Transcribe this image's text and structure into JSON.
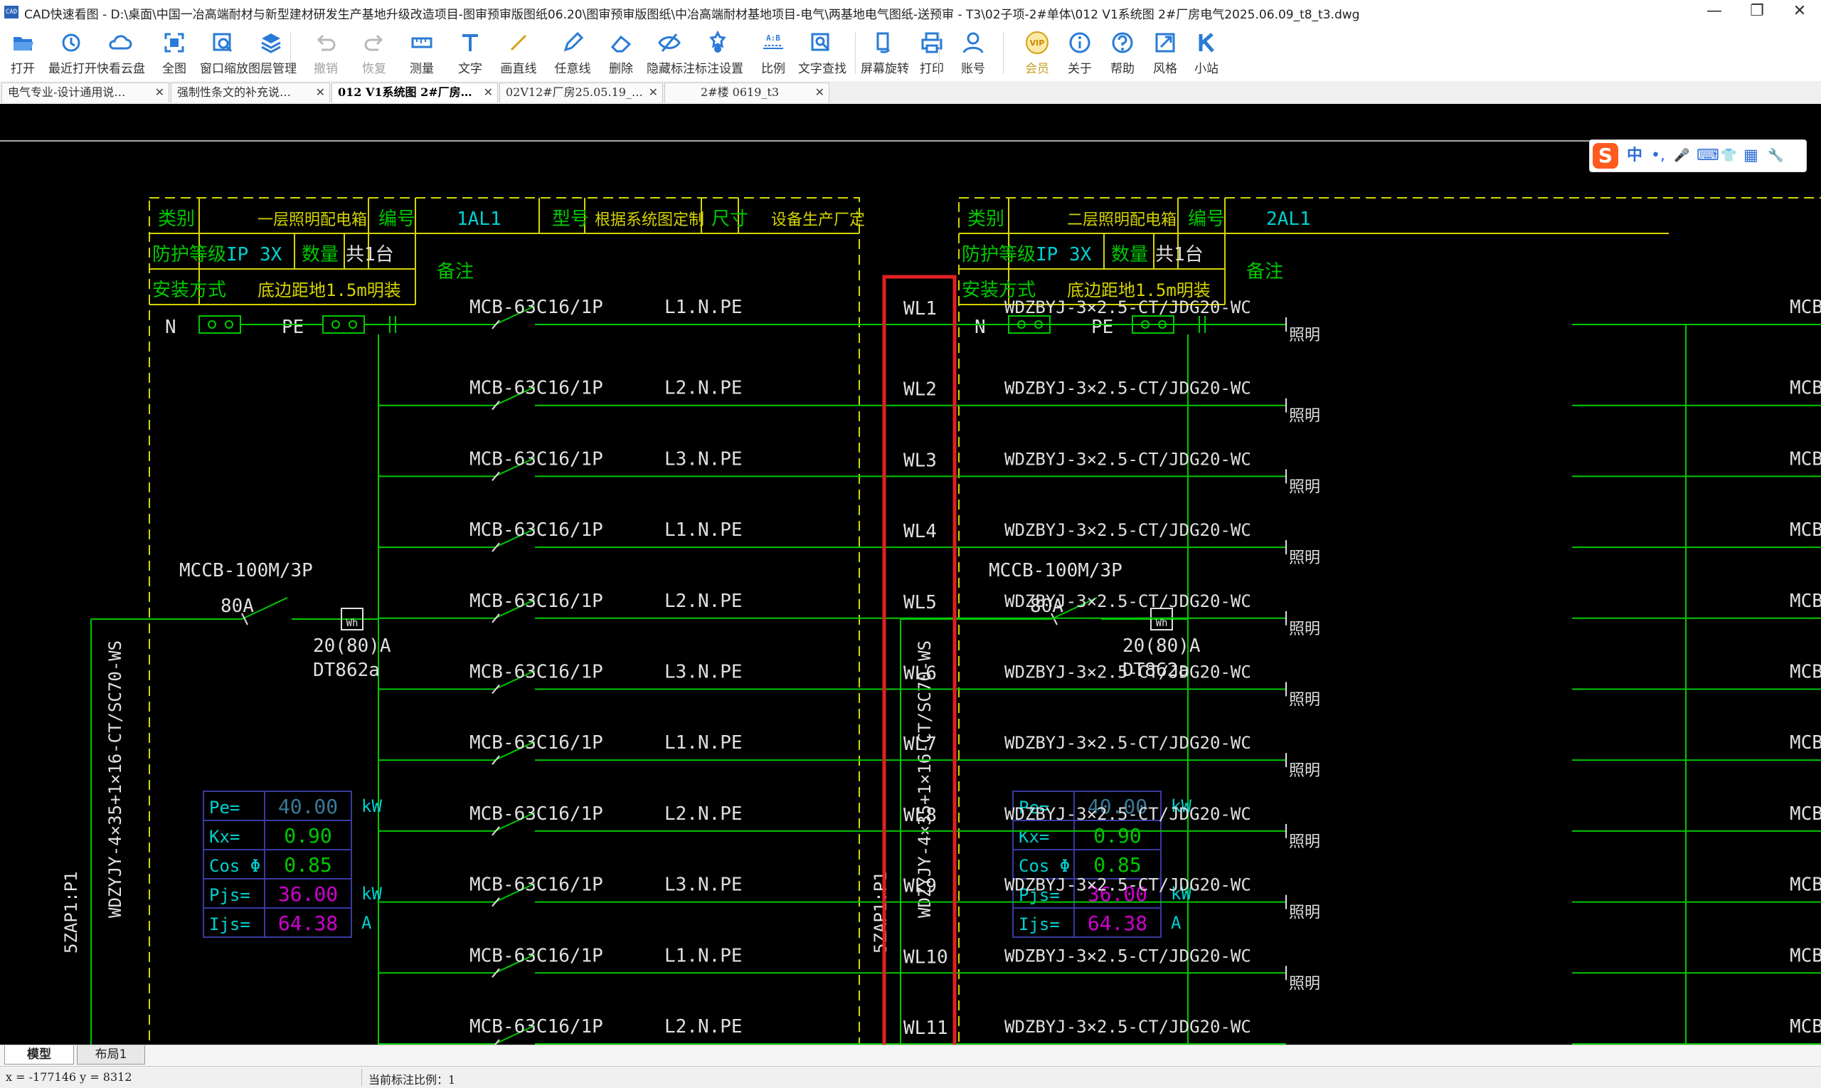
{
  "app": {
    "logo": "CAD",
    "window_title": "CAD快速看图 - D:\\桌面\\中国一冶高端耐材与新型建材研发生产基地升级改造项目-图审预审版图纸06.20\\图审预审版图纸\\中冶高端耐材基地项目-电气\\两基地电气图纸-送预审 - T3\\02子项-2#单体\\012 V1系统图 2#厂房电气2025.06.09_t8_t3.dwg",
    "controls": {
      "minimize": "—",
      "maximize": "❐",
      "close": "✕"
    }
  },
  "toolbar": [
    {
      "label": "打开",
      "icon": "folder-open-icon",
      "enabled": true
    },
    {
      "label": "最近打开",
      "icon": "history-icon",
      "enabled": true
    },
    {
      "label": "快看云盘",
      "icon": "cloud-icon",
      "enabled": true
    },
    {
      "label": "全图",
      "icon": "fit-all-icon",
      "enabled": true
    },
    {
      "label": "窗口缩放",
      "icon": "zoom-window-icon",
      "enabled": true
    },
    {
      "label": "图层管理",
      "icon": "layers-icon",
      "enabled": true
    },
    {
      "label": "撤销",
      "icon": "undo-icon",
      "enabled": false
    },
    {
      "label": "恢复",
      "icon": "redo-icon",
      "enabled": false
    },
    {
      "label": "测量",
      "icon": "measure-icon",
      "enabled": true
    },
    {
      "label": "文字",
      "icon": "text-icon",
      "enabled": true
    },
    {
      "label": "画直线",
      "icon": "line-icon",
      "enabled": true
    },
    {
      "label": "任意线",
      "icon": "pencil-icon",
      "enabled": true
    },
    {
      "label": "删除",
      "icon": "eraser-icon",
      "enabled": true
    },
    {
      "label": "隐藏标注",
      "icon": "eye-hide-icon",
      "enabled": true
    },
    {
      "label": "标注设置",
      "icon": "annotation-settings-icon",
      "enabled": true
    },
    {
      "label": "比例",
      "icon": "scale-icon",
      "enabled": true
    },
    {
      "label": "文字查找",
      "icon": "text-search-icon",
      "enabled": true
    },
    {
      "label": "屏幕旋转",
      "icon": "rotate-screen-icon",
      "enabled": true
    },
    {
      "label": "打印",
      "icon": "printer-icon",
      "enabled": true
    },
    {
      "label": "账号",
      "icon": "user-icon",
      "enabled": true
    },
    {
      "label": "会员",
      "icon": "vip-icon",
      "enabled": true
    },
    {
      "label": "关于",
      "icon": "info-icon",
      "enabled": true
    },
    {
      "label": "帮助",
      "icon": "help-icon",
      "enabled": true
    },
    {
      "label": "风格",
      "icon": "style-icon",
      "enabled": true
    },
    {
      "label": "小站",
      "icon": "site-k-icon",
      "enabled": true
    }
  ],
  "scale_icon_text": "A:B",
  "vip_icon_text": "VIP",
  "doc_tabs": [
    {
      "label": "电气专业-设计通用说…",
      "active": false
    },
    {
      "label": "强制性条文的补充说…",
      "active": false
    },
    {
      "label": "012 V1系统图 2#厂房…",
      "active": true
    },
    {
      "label": "02V12#厂房25.05.19_…",
      "active": false
    },
    {
      "label": "2#楼 0619_t3",
      "active": false
    }
  ],
  "tab_close": "✕",
  "ime": {
    "logo": "S",
    "mode": "中",
    "punct": "•,",
    "mic": "🎤",
    "keyboard": "⌨",
    "skin": "👕",
    "apps": "▦",
    "tools": "🔧"
  },
  "panel_left": {
    "header": {
      "category_label": "类别",
      "category_value": "一层照明配电箱",
      "number_label": "编号",
      "number_value": "1AL1",
      "model_label": "型号",
      "model_value": "根据系统图定制",
      "size_label": "尺寸",
      "size_value": "设备生产厂定",
      "protection_label": "防护等级",
      "protection_value": "IP 3X",
      "qty_label": "数量",
      "qty_value": "共1台",
      "install_label": "安装方式",
      "install_value": "底边距地1.5m明装",
      "remark_label": "备注"
    },
    "busbars": {
      "n": "N",
      "pe": "PE"
    },
    "main_breaker": {
      "model": "MCCB-100M/3P",
      "rating": "80A"
    },
    "meter": {
      "symbol": "Wh",
      "rating": "20(80)A",
      "model": "DT862a"
    },
    "incoming": {
      "cable": "WDZYJY-4×35+1×16-CT/SC70-WS",
      "source": "5ZAP1:P1"
    },
    "load_calc": [
      {
        "label": "Pe=",
        "value": "40.00",
        "unit": "kW"
      },
      {
        "label": "Kx=",
        "value": "0.90",
        "unit": ""
      },
      {
        "label": "Cos Φ",
        "value": "0.85",
        "unit": ""
      },
      {
        "label": "Pjs=",
        "value": "36.00",
        "unit": "kW"
      },
      {
        "label": "Ijs=",
        "value": "64.38",
        "unit": "A"
      }
    ]
  },
  "circuits": [
    {
      "breaker": "MCB-63C16/1P",
      "phase": "L1.N.PE",
      "id": "WL1",
      "cable": "WDZBYJ-3×2.5-CT/JDG20-WC",
      "load": "照明"
    },
    {
      "breaker": "MCB-63C16/1P",
      "phase": "L2.N.PE",
      "id": "WL2",
      "cable": "WDZBYJ-3×2.5-CT/JDG20-WC",
      "load": "照明"
    },
    {
      "breaker": "MCB-63C16/1P",
      "phase": "L3.N.PE",
      "id": "WL3",
      "cable": "WDZBYJ-3×2.5-CT/JDG20-WC",
      "load": "照明"
    },
    {
      "breaker": "MCB-63C16/1P",
      "phase": "L1.N.PE",
      "id": "WL4",
      "cable": "WDZBYJ-3×2.5-CT/JDG20-WC",
      "load": "照明"
    },
    {
      "breaker": "MCB-63C16/1P",
      "phase": "L2.N.PE",
      "id": "WL5",
      "cable": "WDZBYJ-3×2.5-CT/JDG20-WC",
      "load": "照明"
    },
    {
      "breaker": "MCB-63C16/1P",
      "phase": "L3.N.PE",
      "id": "WL6",
      "cable": "WDZBYJ-3×2.5-CT/JDG20-WC",
      "load": "照明"
    },
    {
      "breaker": "MCB-63C16/1P",
      "phase": "L1.N.PE",
      "id": "WL7",
      "cable": "WDZBYJ-3×2.5-CT/JDG20-WC",
      "load": "照明"
    },
    {
      "breaker": "MCB-63C16/1P",
      "phase": "L2.N.PE",
      "id": "WL8",
      "cable": "WDZBYJ-3×2.5-CT/JDG20-WC",
      "load": "照明"
    },
    {
      "breaker": "MCB-63C16/1P",
      "phase": "L3.N.PE",
      "id": "WL9",
      "cable": "WDZBYJ-3×2.5-CT/JDG20-WC",
      "load": "照明"
    },
    {
      "breaker": "MCB-63C16/1P",
      "phase": "L1.N.PE",
      "id": "WL10",
      "cable": "WDZBYJ-3×2.5-CT/JDG20-WC",
      "load": "照明"
    },
    {
      "breaker": "MCB-63C16/1P",
      "phase": "L2.N.PE",
      "id": "WL11",
      "cable": "WDZBYJ-3×2.5-CT/JDG20-WC",
      "load": ""
    }
  ],
  "panel_right": {
    "header": {
      "category_label": "类别",
      "category_value": "二层照明配电箱",
      "number_label": "编号",
      "number_value": "2AL1",
      "protection_label": "防护等级",
      "protection_value": "IP 3X",
      "qty_label": "数量",
      "qty_value": "共1台",
      "install_label": "安装方式",
      "install_value": "底边距地1.5m明装",
      "remark_label": "备注"
    },
    "busbars": {
      "n": "N",
      "pe": "PE"
    },
    "main_breaker": {
      "model": "MCCB-100M/3P",
      "rating": "80A"
    },
    "meter": {
      "symbol": "Wh",
      "rating": "20(80)A",
      "model": "DT862a"
    },
    "incoming": {
      "cable": "WDZYJY-4×35+1×16-CT/SC70-WS",
      "source": "5ZAP1:P1"
    },
    "load_calc": [
      {
        "label": "Pe=",
        "value": "40.00",
        "unit": "kW"
      },
      {
        "label": "Kx=",
        "value": "0.90",
        "unit": ""
      },
      {
        "label": "Cos Φ",
        "value": "0.85",
        "unit": ""
      },
      {
        "label": "Pjs=",
        "value": "36.00",
        "unit": "kW"
      },
      {
        "label": "Ijs=",
        "value": "64.38",
        "unit": "A"
      }
    ],
    "breaker_partial": "MCB"
  },
  "layout_tabs": [
    {
      "label": "模型",
      "active": true
    },
    {
      "label": "布局1",
      "active": false
    }
  ],
  "status": {
    "coords": "x = -177146  y = 8312",
    "scale": "当前标注比例：1"
  },
  "colors": {
    "cad_background": "#000000",
    "cad_green": "#00c800",
    "cad_yellow": "#d4d400",
    "cad_cyan": "#00d0d0",
    "cad_white": "#e0e0e0",
    "cad_magenta": "#d000d0",
    "cad_blue_grid": "#3a3aa0",
    "highlight_red": "#e02020",
    "toolbar_icon": "#2a7bd6"
  }
}
